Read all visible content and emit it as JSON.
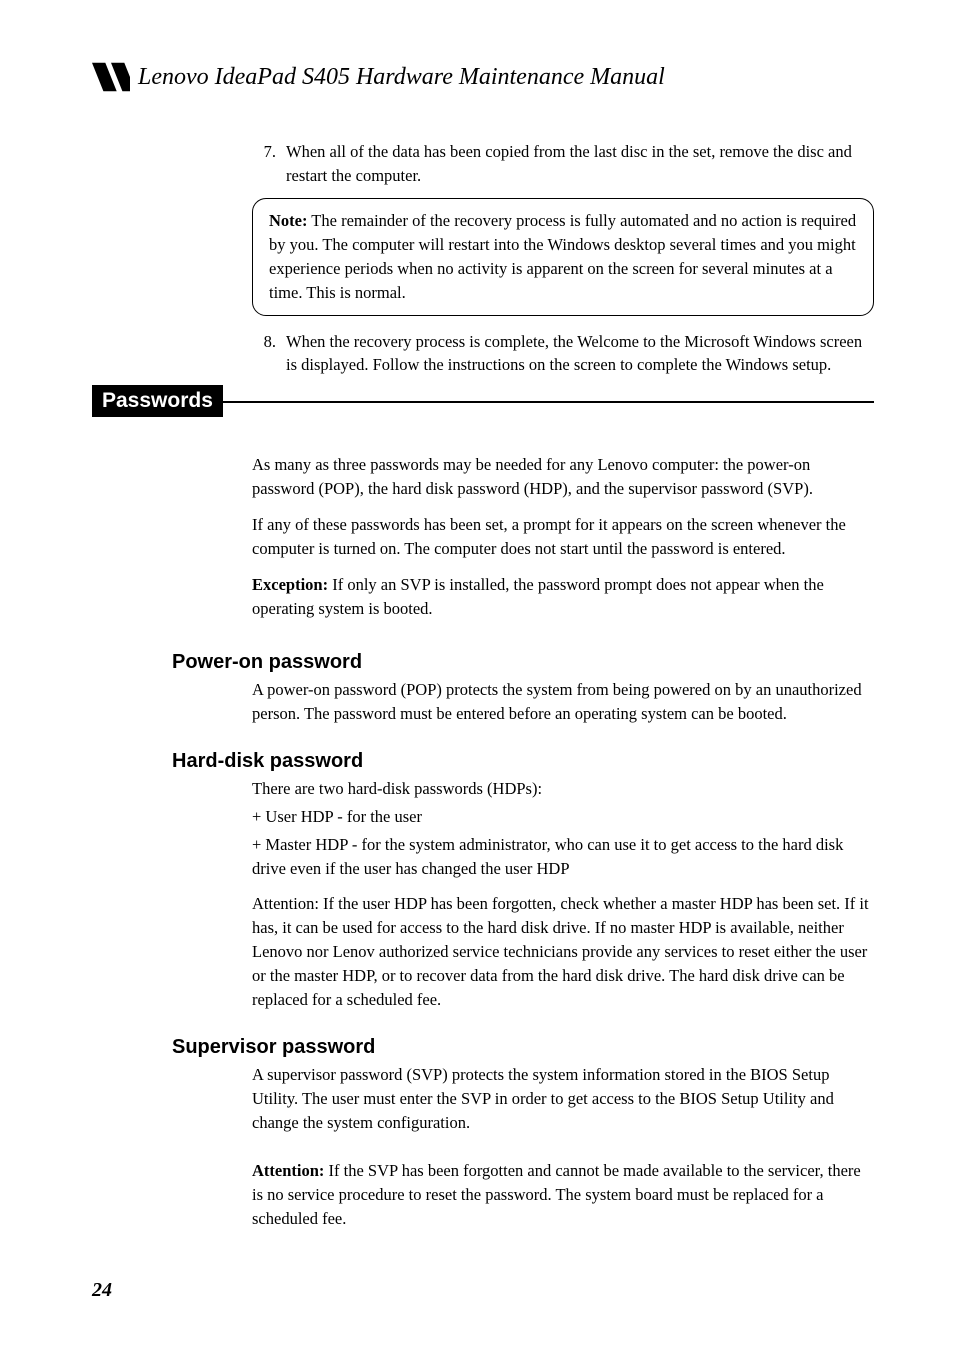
{
  "header": {
    "title": "Lenovo IdeaPad S405 Hardware Maintenance Manual"
  },
  "steps": {
    "s7_num": "7.",
    "s7_text": "When all of the data has been copied from the last disc in the set, remove the disc and restart the computer.",
    "note_label": "Note:",
    "note_text": " The remainder of the recovery process is fully automated and no action is required by you. The computer will restart into the Windows desktop several times and you might experience periods when no activity is apparent on the screen for several minutes at a time. This is normal.",
    "s8_num": "8.",
    "s8_text": "When the recovery process is complete, the Welcome to the Microsoft Windows screen is displayed. Follow the instructions on the screen to complete the Windows setup."
  },
  "passwords": {
    "heading": "Passwords",
    "p1": "As many as three passwords may be needed for any Lenovo computer: the power-on password (POP), the hard disk password (HDP), and the supervisor password (SVP).",
    "p2": "If any of these passwords has been set, a prompt for it appears on the screen whenever the computer is turned on. The computer does not start until the password is entered.",
    "p3_label": "Exception:",
    "p3_text": " If only an SVP is installed, the password prompt does not appear when the operating system is booted."
  },
  "pop": {
    "heading": "Power-on password",
    "p1": "A power-on password (POP) protects the system from being powered on by an unauthorized person. The password must be entered before an operating system can be booted."
  },
  "hdp": {
    "heading": "Hard-disk password",
    "p1": "There are two hard-disk passwords (HDPs):",
    "p2": "+ User HDP - for the user",
    "p3": "+ Master HDP - for the system administrator, who can use it to get access to the hard disk drive even if the user has changed the user HDP",
    "p4": "Attention: If the user HDP has been forgotten, check whether a master HDP has been set. If it has, it can be used for access to the hard disk drive. If no master HDP is available, neither Lenovo nor Lenov authorized service technicians provide any services to reset either the user or the master HDP, or to recover data from the hard disk drive. The hard disk drive can be replaced for a scheduled fee."
  },
  "svp": {
    "heading": "Supervisor password",
    "p1": "A supervisor password (SVP) protects the system information stored in the BIOS Setup Utility. The user must enter the SVP in order to get access to the BIOS Setup Utility and change the system configuration.",
    "p2_label": "Attention:",
    "p2_text": " If the SVP has been forgotten and cannot be made available to the servicer, there is no service procedure to reset the password. The system board must be replaced for a scheduled fee."
  },
  "footer": {
    "page": "24"
  }
}
